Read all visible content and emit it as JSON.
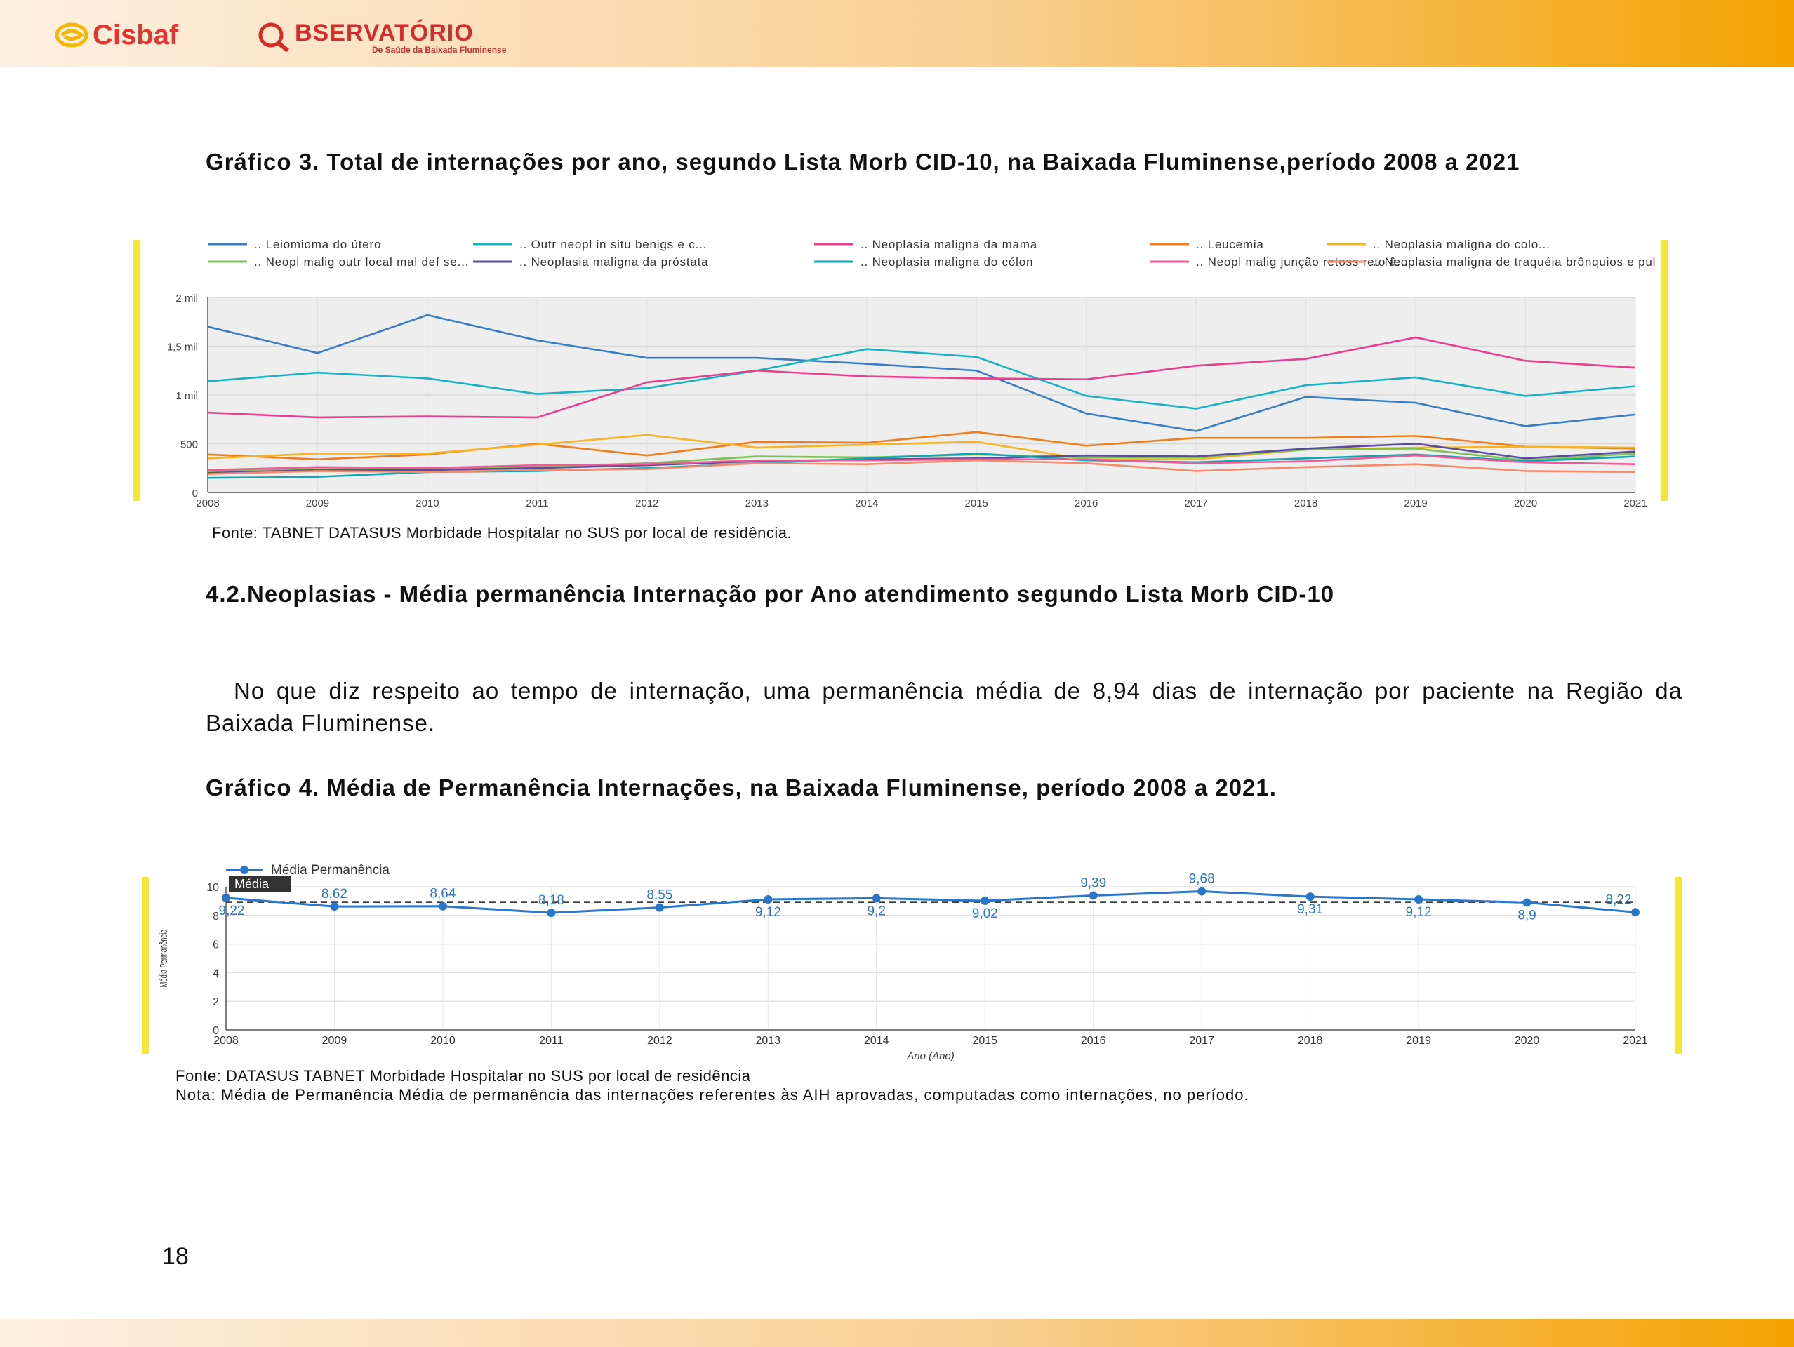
{
  "header": {
    "logo_cisbaf": "Cisbaf",
    "logo_observatorio": "BSERVATÓRIO",
    "logo_observatorio_sub": "De Saúde da Baixada Fluminense",
    "colors": {
      "band_start": "#fdf0e2",
      "band_end": "#f4a200",
      "logo_red": "#d42b2b"
    }
  },
  "grafico3": {
    "title": "Gráfico 3. Total de internações por ano, segundo Lista Morb CID-10, na Baixada Fluminense,período 2008 a 2021",
    "source": "Fonte: TABNET DATASUS Morbidade Hospitalar no SUS por local de residência."
  },
  "section42": {
    "title": "4.2.Neoplasias - Média permanência Internação por Ano atendimento segundo Lista Morb CID-10",
    "paragraph": "No que diz respeito ao tempo de internação, uma permanência média de 8,94 dias de internação por paciente na Região da Baixada Fluminense."
  },
  "grafico4": {
    "title": "Gráfico 4. Média de Permanência Internações, na Baixada Fluminense, período 2008 a 2021.",
    "source": "Fonte: DATASUS TABNET Morbidade Hospitalar no SUS por local de residência",
    "note": "Nota: Média de Permanência Média de permanência das internações referentes às AIH aprovadas, computadas como internações, no período."
  },
  "page_number": "18",
  "chart_data": [
    {
      "type": "line",
      "x": [
        2008,
        2009,
        2010,
        2011,
        2012,
        2013,
        2014,
        2015,
        2016,
        2017,
        2018,
        2019,
        2020,
        2021
      ],
      "ylim": [
        0,
        2000
      ],
      "yticks": [
        0,
        500,
        1000,
        1500,
        2000
      ],
      "ytick_labels": [
        "0",
        "500",
        "1 mil",
        "1,5 mil",
        "2 mil"
      ],
      "legend": "top",
      "grid": true,
      "series": [
        {
          "name": ".. Leiomioma do útero",
          "color": "#3a7cc4",
          "values": [
            1700,
            1430,
            1820,
            1560,
            1380,
            1380,
            1320,
            1250,
            810,
            630,
            980,
            920,
            680,
            800
          ]
        },
        {
          "name": ".. Outr neopl in situ benigs e c...",
          "color": "#1ab0c4",
          "values": [
            1140,
            1230,
            1170,
            1010,
            1070,
            1250,
            1470,
            1390,
            990,
            860,
            1100,
            1180,
            990,
            1090
          ]
        },
        {
          "name": ".. Neoplasia maligna da mama",
          "color": "#e83e8c",
          "values": [
            820,
            770,
            780,
            770,
            1130,
            1250,
            1190,
            1170,
            1160,
            1300,
            1370,
            1590,
            1350,
            1280
          ]
        },
        {
          "name": ".. Leucemia",
          "color": "#f07d1a",
          "values": [
            390,
            340,
            390,
            500,
            380,
            520,
            510,
            620,
            480,
            560,
            560,
            580,
            470,
            450
          ]
        },
        {
          "name": ".. Neoplasia maligna do colo...",
          "color": "#f5b325",
          "values": [
            350,
            400,
            400,
            490,
            590,
            460,
            490,
            520,
            340,
            340,
            440,
            460,
            470,
            460
          ]
        },
        {
          "name": ".. Neopl malig outr local mal def se...",
          "color": "#7cc157",
          "values": [
            220,
            240,
            240,
            260,
            300,
            370,
            360,
            390,
            360,
            360,
            440,
            450,
            330,
            400
          ]
        },
        {
          "name": ".. Neoplasia maligna da próstata",
          "color": "#5a4b9e",
          "values": [
            200,
            230,
            230,
            250,
            280,
            320,
            340,
            350,
            380,
            370,
            450,
            500,
            350,
            420
          ]
        },
        {
          "name": ".. Neoplasia maligna do cólon",
          "color": "#13a4b4",
          "values": [
            150,
            160,
            210,
            220,
            250,
            300,
            350,
            400,
            330,
            310,
            350,
            390,
            320,
            370
          ]
        },
        {
          "name": ".. Neopl malig junção retoss reto â...",
          "color": "#ee5a96",
          "values": [
            230,
            260,
            250,
            280,
            290,
            330,
            330,
            340,
            340,
            300,
            320,
            380,
            310,
            290
          ]
        },
        {
          "name": ".. Neoplasia maligna de traquéia brônquios e pulm",
          "color": "#f48a6a",
          "values": [
            190,
            220,
            210,
            230,
            240,
            300,
            290,
            330,
            300,
            220,
            260,
            290,
            220,
            210
          ]
        }
      ]
    },
    {
      "type": "line",
      "x": [
        2008,
        2009,
        2010,
        2011,
        2012,
        2013,
        2014,
        2015,
        2016,
        2017,
        2018,
        2019,
        2020,
        2021
      ],
      "ylim": [
        0,
        10
      ],
      "yticks": [
        0,
        2,
        4,
        6,
        8,
        10
      ],
      "ylabel": "Média Permanência",
      "xlabel": "Ano (Ano)",
      "legend": "top-left",
      "grid": true,
      "series": [
        {
          "name": "Média Permanência",
          "color": "#2a77c9",
          "values": [
            9.22,
            8.62,
            8.64,
            8.18,
            8.55,
            9.12,
            9.2,
            9.02,
            9.39,
            9.68,
            9.31,
            9.12,
            8.9,
            8.22
          ],
          "labels": [
            "9,22",
            "8,62",
            "8,64",
            "8,18",
            "8,55",
            "9,12",
            "9,2",
            "9,02",
            "9,39",
            "9,68",
            "9,31",
            "9,12",
            "8,9",
            "8,22"
          ]
        }
      ],
      "reference_line": {
        "label": "Média",
        "value": 8.94,
        "color": "#222222"
      }
    }
  ]
}
